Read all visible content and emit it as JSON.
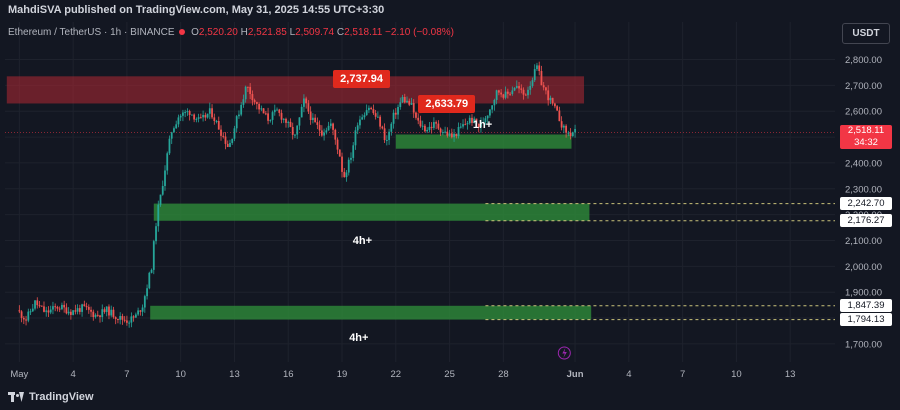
{
  "header": {
    "published_by": "MahdiSVA published on TradingView.com, May 31, 2025 14:55 UTC+3:30"
  },
  "symbol_bar": {
    "name": "Ethereum / TetherUS · 1h · BINANCE",
    "o_label": "O",
    "o_value": "2,520.20",
    "h_label": "H",
    "h_value": "2,521.85",
    "l_label": "L",
    "l_value": "2,509.74",
    "c_label": "C",
    "c_value": "2,518.11",
    "change": "−2.10 (−0.08%)",
    "change_color": "#f23645"
  },
  "currency_button": "USDT",
  "footer": {
    "logo_text": "TradingView"
  },
  "chart_data": {
    "type": "line",
    "chart_style": "candlestick",
    "symbol": "ETH/USDT",
    "interval": "1h",
    "y_axis": {
      "ticks": [
        1700,
        1800,
        1900,
        2000,
        2100,
        2200,
        2300,
        2400,
        2500,
        2600,
        2700,
        2800
      ],
      "tick_labels": [
        "1,700.00",
        "1,800.00",
        "1,900.00",
        "2,000.00",
        "2,100.00",
        "2,200.00",
        "2,300.00",
        "2,400.00",
        "2,500.00",
        "2,600.00",
        "2,700.00",
        "2,800.00"
      ],
      "ylim": [
        1630,
        2860
      ]
    },
    "x_axis": {
      "ticks": [
        1,
        4,
        7,
        10,
        13,
        16,
        19,
        22,
        25,
        28,
        32,
        35,
        38,
        41,
        44
      ],
      "tick_labels": [
        "May",
        "4",
        "7",
        "10",
        "13",
        "16",
        "19",
        "22",
        "25",
        "28",
        "Jun",
        "4",
        "7",
        "10",
        "13"
      ],
      "xlim": [
        0.2,
        46.5
      ],
      "bold_labels": [
        "Jun"
      ]
    },
    "last_price": {
      "value": 2518.11,
      "label": "2,518.11",
      "countdown": "34:32",
      "color": "#f23645"
    },
    "price_path": [
      [
        1.0,
        1830
      ],
      [
        1.5,
        1795
      ],
      [
        2.0,
        1860
      ],
      [
        2.6,
        1820
      ],
      [
        3.3,
        1845
      ],
      [
        4.0,
        1825
      ],
      [
        4.7,
        1840
      ],
      [
        5.4,
        1810
      ],
      [
        6.0,
        1830
      ],
      [
        6.7,
        1800
      ],
      [
        7.2,
        1790
      ],
      [
        7.6,
        1805
      ],
      [
        8.0,
        1850
      ],
      [
        8.5,
        2000
      ],
      [
        8.8,
        2200
      ],
      [
        9.0,
        2270
      ],
      [
        9.3,
        2400
      ],
      [
        9.6,
        2520
      ],
      [
        10.0,
        2580
      ],
      [
        10.6,
        2600
      ],
      [
        11.2,
        2560
      ],
      [
        11.8,
        2600
      ],
      [
        12.3,
        2530
      ],
      [
        12.8,
        2460
      ],
      [
        13.3,
        2580
      ],
      [
        13.8,
        2700
      ],
      [
        14.4,
        2620
      ],
      [
        15.0,
        2570
      ],
      [
        15.5,
        2600
      ],
      [
        16.0,
        2560
      ],
      [
        16.5,
        2500
      ],
      [
        17.0,
        2640
      ],
      [
        17.5,
        2560
      ],
      [
        18.0,
        2520
      ],
      [
        18.5,
        2550
      ],
      [
        19.0,
        2430
      ],
      [
        19.2,
        2340
      ],
      [
        19.6,
        2420
      ],
      [
        20.0,
        2560
      ],
      [
        20.6,
        2620
      ],
      [
        21.2,
        2560
      ],
      [
        21.6,
        2480
      ],
      [
        22.0,
        2580
      ],
      [
        22.5,
        2650
      ],
      [
        23.0,
        2620
      ],
      [
        23.3,
        2560
      ],
      [
        23.8,
        2530
      ],
      [
        24.3,
        2550
      ],
      [
        24.8,
        2520
      ],
      [
        25.3,
        2500
      ],
      [
        25.8,
        2540
      ],
      [
        26.3,
        2570
      ],
      [
        26.8,
        2540
      ],
      [
        27.3,
        2600
      ],
      [
        27.8,
        2680
      ],
      [
        28.3,
        2660
      ],
      [
        28.8,
        2700
      ],
      [
        29.3,
        2660
      ],
      [
        29.7,
        2720
      ],
      [
        30.0,
        2770
      ],
      [
        30.3,
        2700
      ],
      [
        30.6,
        2660
      ],
      [
        30.9,
        2620
      ],
      [
        31.2,
        2580
      ],
      [
        31.5,
        2530
      ],
      [
        31.8,
        2510
      ],
      [
        32.0,
        2518
      ]
    ],
    "zones": [
      {
        "type": "supply",
        "x0": 0.3,
        "x1": 32.5,
        "y_low": 2630,
        "y_high": 2735,
        "color": "#b22833"
      },
      {
        "type": "demand",
        "x0": 22.0,
        "x1": 31.8,
        "y_low": 2455,
        "y_high": 2510,
        "label": "1h+",
        "color": "#2e8b3a"
      },
      {
        "type": "demand",
        "x0": 8.5,
        "x1": 32.8,
        "y_low": 2176.27,
        "y_high": 2242.7,
        "label": "4h+",
        "color": "#2e8b3a"
      },
      {
        "type": "demand",
        "x0": 8.3,
        "x1": 32.9,
        "y_low": 1794.13,
        "y_high": 1847.39,
        "label": "4h+",
        "color": "#2e8b3a"
      }
    ],
    "level_tags": [
      {
        "value": 2242.7,
        "label": "2,242.70"
      },
      {
        "value": 2176.27,
        "label": "2,176.27"
      },
      {
        "value": 1847.39,
        "label": "1,847.39"
      },
      {
        "value": 1794.13,
        "label": "1,794.13"
      }
    ],
    "callouts": [
      {
        "label": "2,737.94",
        "value": 2737.94
      },
      {
        "label": "2,633.79",
        "value": 2633.79
      }
    ],
    "colors": {
      "up": "#26a69a",
      "down": "#ef5350",
      "background": "#131722",
      "grid": "#1e222d"
    }
  }
}
